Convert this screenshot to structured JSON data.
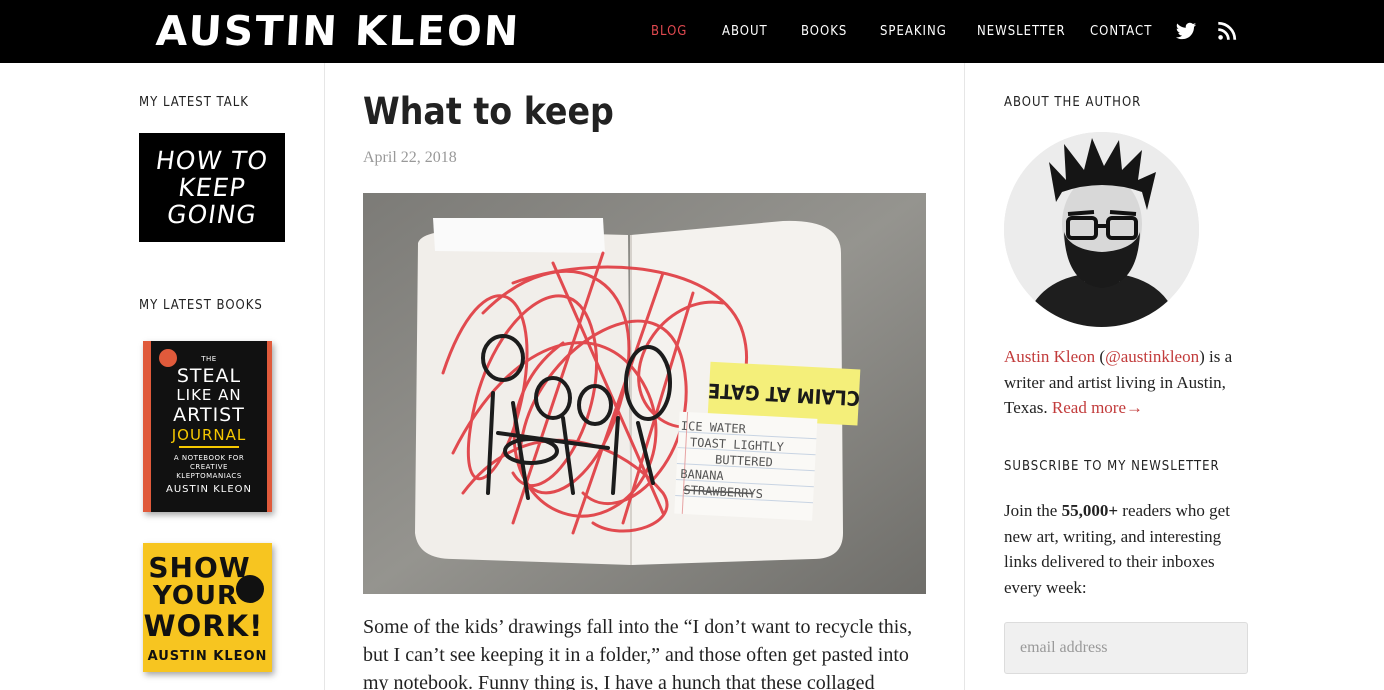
{
  "header": {
    "logo": "AUSTIN KLEON",
    "nav": [
      "BLOG",
      "ABOUT",
      "BOOKS",
      "SPEAKING",
      "NEWSLETTER",
      "CONTACT"
    ],
    "active_nav": "BLOG",
    "icons": [
      "twitter-icon",
      "rss-icon"
    ]
  },
  "left_sidebar": {
    "talk_title": "MY LATEST TALK",
    "talk_lines": [
      "HOW TO",
      "KEEP",
      "GOING"
    ],
    "books_title": "MY LATEST BOOKS",
    "book1": {
      "lines": [
        "THE",
        "STEAL",
        "LIKE AN",
        "ARTIST",
        "JOURNAL"
      ],
      "subtitle": "A NOTEBOOK FOR CREATIVE KLEPTOMANIACS",
      "author": "AUSTIN KLEON"
    },
    "book2": {
      "lines": [
        "SHOW",
        "YOUR",
        "WORK!"
      ],
      "author": "AUSTIN KLEON"
    }
  },
  "post": {
    "title": "What to keep",
    "date": "April 22, 2018",
    "image_text": {
      "sticker": "CLAIM AT GATE",
      "note": [
        "ICE WATER",
        "TOAST LIGHTLY",
        "BUTTERED",
        "BANANA",
        "STRAWBERRYS"
      ]
    },
    "body": "Some of the kids’ drawings fall into the “I don’t want to recycle this, but I can’t see keeping it in a folder,” and those often get pasted into my notebook. Funny thing is, I have a hunch that these collaged"
  },
  "right_sidebar": {
    "about_title": "ABOUT THE AUTHOR",
    "bio_name": "Austin Kleon",
    "bio_open": " (",
    "bio_handle": "@austinkleon",
    "bio_rest": ") is a writer and artist living in Austin, Texas. ",
    "read_more": "Read more→",
    "newsletter_title": "SUBSCRIBE TO MY NEWSLETTER",
    "newsletter_pre": "Join the ",
    "newsletter_count": "55,000+",
    "newsletter_post": " readers who get new art, writing, and interesting links delivered to their inboxes every week:",
    "email_placeholder": "email address"
  },
  "colors": {
    "accent": "#c23b3b",
    "nav_active": "#e0494f",
    "header_bg": "#000000"
  }
}
